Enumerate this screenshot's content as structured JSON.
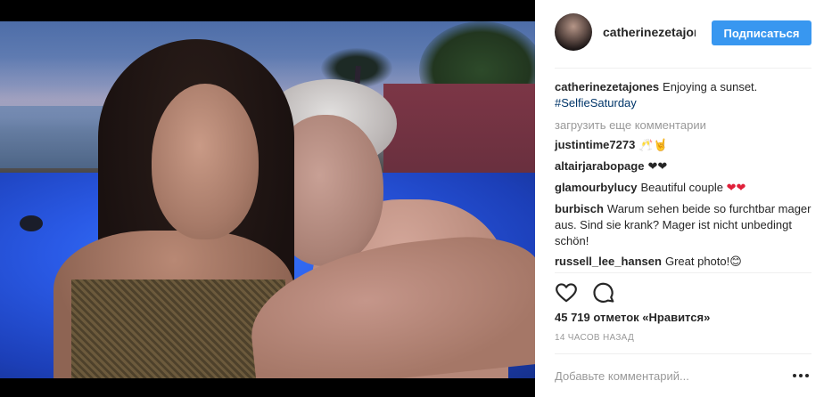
{
  "post": {
    "username": "catherinezetajones",
    "follow_label": "Подписаться",
    "caption": {
      "username": "catherinezetajones",
      "text": "Enjoying a sunset.",
      "hashtag": "#SelfieSaturday"
    },
    "load_more_label": "загрузить еще комментарии",
    "comments": [
      {
        "username": "justintime7273",
        "text": "",
        "emoji": "🥂🤘"
      },
      {
        "username": "altairjarabopage",
        "text": "",
        "emoji": "❤❤"
      },
      {
        "username": "glamourbylucy",
        "text": "Beautiful couple",
        "emoji": "❤❤"
      },
      {
        "username": "burbisch",
        "text": "Warum sehen beide so furchtbar mager aus. Sind sie krank? Mager ist nicht unbedingt schön!",
        "emoji": ""
      },
      {
        "username": "russell_lee_hansen",
        "text": "Great photo!",
        "emoji": "😊"
      }
    ],
    "likes_label": "45 719 отметок «Нравится»",
    "time_label": "14 ЧАСОВ НАЗАД",
    "comment_placeholder": "Добавьте комментарий...",
    "icons": {
      "like": "heart-outline-icon",
      "comment": "speech-bubble-icon",
      "more": "more-dots-icon"
    },
    "colors": {
      "follow_button": "#3897f0",
      "hashtag": "#003569",
      "muted_text": "#999999",
      "heart": "#e0203a"
    }
  }
}
